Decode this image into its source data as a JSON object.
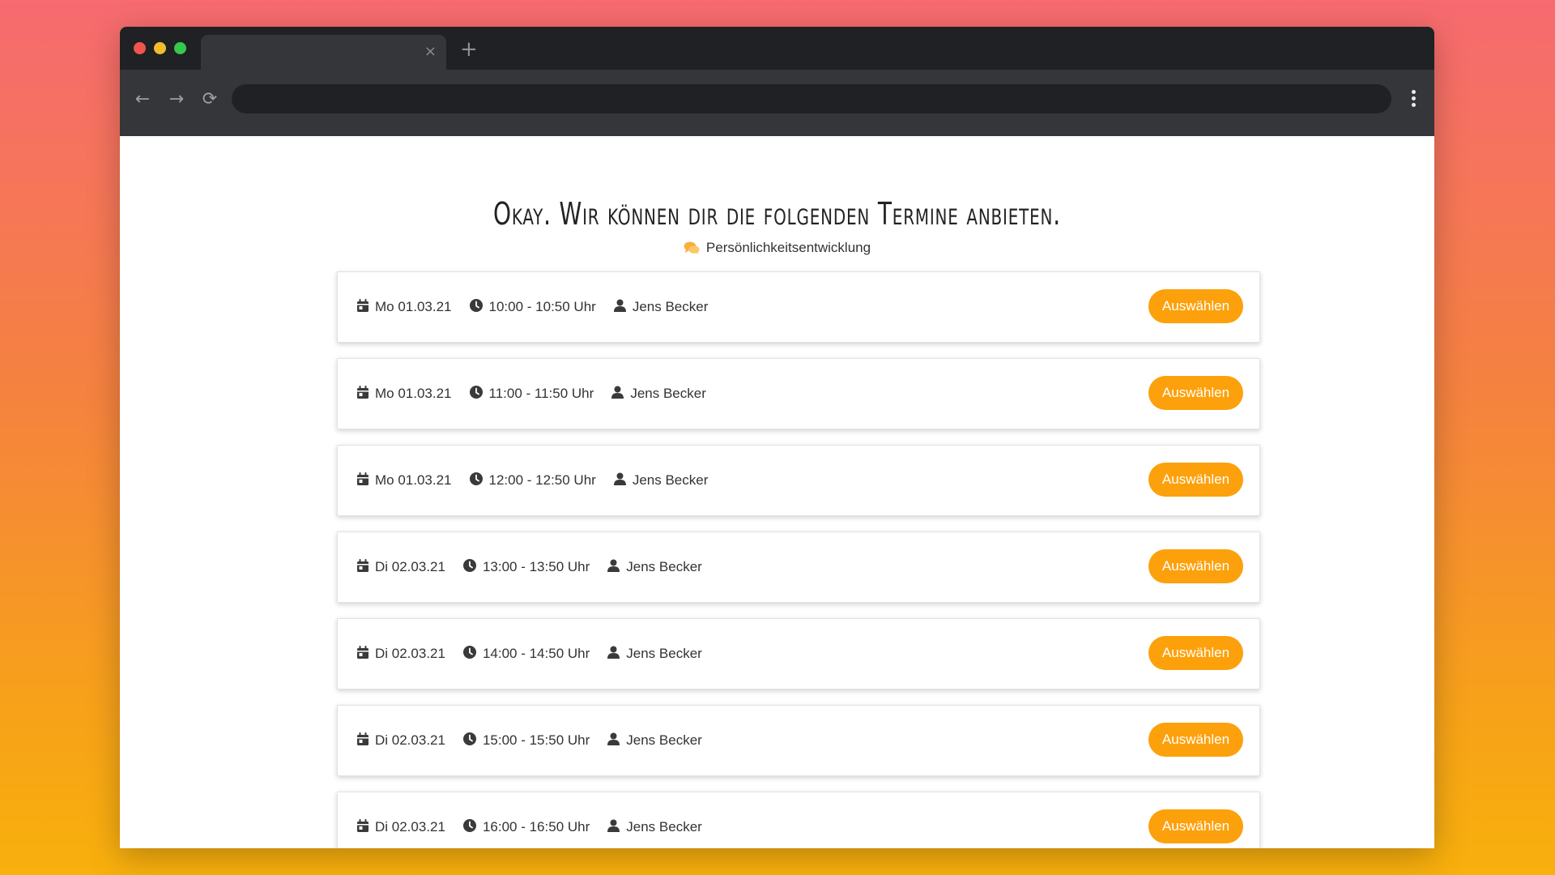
{
  "browser": {
    "tab_close": "×",
    "new_tab": "+",
    "back": "←",
    "forward": "→",
    "reload": "⟳"
  },
  "page": {
    "heading": "Okay. Wir können dir die folgenden Termine anbieten.",
    "category": "Persönlichkeitsentwicklung",
    "accent_color": "#fca10c"
  },
  "slots": [
    {
      "date": "Mo 01.03.21",
      "time": "10:00 - 10:50 Uhr",
      "person": "Jens Becker",
      "action": "Auswählen"
    },
    {
      "date": "Mo 01.03.21",
      "time": "11:00 - 11:50 Uhr",
      "person": "Jens Becker",
      "action": "Auswählen"
    },
    {
      "date": "Mo 01.03.21",
      "time": "12:00 - 12:50 Uhr",
      "person": "Jens Becker",
      "action": "Auswählen"
    },
    {
      "date": "Di 02.03.21",
      "time": "13:00 - 13:50 Uhr",
      "person": "Jens Becker",
      "action": "Auswählen"
    },
    {
      "date": "Di 02.03.21",
      "time": "14:00 - 14:50 Uhr",
      "person": "Jens Becker",
      "action": "Auswählen"
    },
    {
      "date": "Di 02.03.21",
      "time": "15:00 - 15:50 Uhr",
      "person": "Jens Becker",
      "action": "Auswählen"
    },
    {
      "date": "Di 02.03.21",
      "time": "16:00 - 16:50 Uhr",
      "person": "Jens Becker",
      "action": "Auswählen"
    }
  ]
}
